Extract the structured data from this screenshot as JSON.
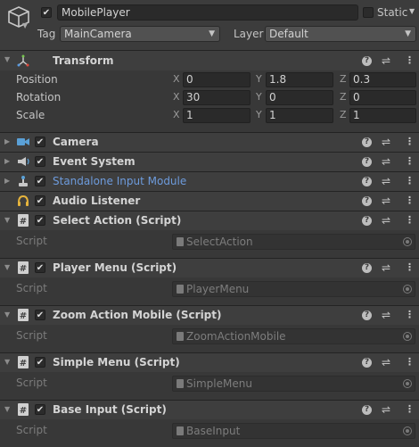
{
  "header": {
    "active": true,
    "object_name": "MobilePlayer",
    "static_label": "Static",
    "static_checked": false,
    "tag_label": "Tag",
    "tag_value": "MainCamera",
    "layer_label": "Layer",
    "layer_value": "Default"
  },
  "transform": {
    "title": "Transform",
    "rows": [
      {
        "label": "Position",
        "x": "0",
        "y": "1.8",
        "z": "0.3"
      },
      {
        "label": "Rotation",
        "x": "30",
        "y": "0",
        "z": "0"
      },
      {
        "label": "Scale",
        "x": "1",
        "y": "1",
        "z": "1"
      }
    ],
    "axis": {
      "x": "X",
      "y": "Y",
      "z": "Z"
    }
  },
  "components": [
    {
      "title": "Camera",
      "icon": "camera-icon"
    },
    {
      "title": "Event System",
      "icon": "event-system-icon"
    },
    {
      "title": "Standalone Input Module",
      "icon": "input-module-icon"
    },
    {
      "title": "Audio Listener",
      "icon": "audio-listener-icon"
    }
  ],
  "scripts": [
    {
      "title": "Select Action (Script)",
      "label": "Script",
      "value": "SelectAction"
    },
    {
      "title": "Player Menu (Script)",
      "label": "Script",
      "value": "PlayerMenu"
    },
    {
      "title": "Zoom Action Mobile (Script)",
      "label": "Script",
      "value": "ZoomActionMobile"
    },
    {
      "title": "Simple Menu (Script)",
      "label": "Script",
      "value": "SimpleMenu"
    },
    {
      "title": "Base Input (Script)",
      "label": "Script",
      "value": "BaseInput"
    }
  ],
  "colors": {
    "background": "#383838",
    "header": "#3e3e3e",
    "link": "#6d9bdc"
  }
}
